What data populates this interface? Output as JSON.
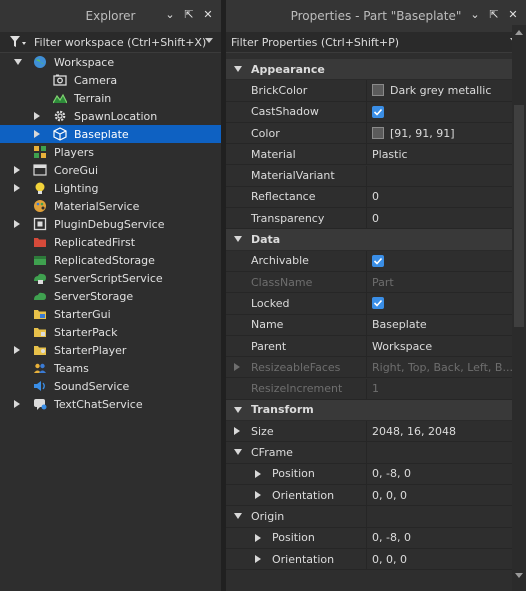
{
  "explorer": {
    "title": "Explorer",
    "filter_placeholder": "Filter workspace (Ctrl+Shift+X)",
    "items": [
      {
        "label": "Workspace",
        "icon": "globe-icon",
        "expander": "down",
        "indent": 0
      },
      {
        "label": "Camera",
        "icon": "camera-icon",
        "expander": "none",
        "indent": 2
      },
      {
        "label": "Terrain",
        "icon": "terrain-icon",
        "expander": "none",
        "indent": 2
      },
      {
        "label": "SpawnLocation",
        "icon": "gear-icon",
        "expander": "right",
        "indent": 1
      },
      {
        "label": "Baseplate",
        "icon": "cube-icon",
        "expander": "right",
        "indent": 1,
        "selected": true
      },
      {
        "label": "Players",
        "icon": "players-icon",
        "expander": "none",
        "indent": 0
      },
      {
        "label": "CoreGui",
        "icon": "window-icon",
        "expander": "right",
        "indent": 0
      },
      {
        "label": "Lighting",
        "icon": "lightbulb-icon",
        "expander": "right",
        "indent": 0
      },
      {
        "label": "MaterialService",
        "icon": "palette-icon",
        "expander": "none",
        "indent": 0
      },
      {
        "label": "PluginDebugService",
        "icon": "square-icon",
        "expander": "right",
        "indent": 0
      },
      {
        "label": "ReplicatedFirst",
        "icon": "red-folder-icon",
        "expander": "none",
        "indent": 0
      },
      {
        "label": "ReplicatedStorage",
        "icon": "green-box-icon",
        "expander": "none",
        "indent": 0
      },
      {
        "label": "ServerScriptService",
        "icon": "script-service-icon",
        "expander": "none",
        "indent": 0
      },
      {
        "label": "ServerStorage",
        "icon": "cloud-icon",
        "expander": "none",
        "indent": 0
      },
      {
        "label": "StarterGui",
        "icon": "folder-gui-icon",
        "expander": "none",
        "indent": 0
      },
      {
        "label": "StarterPack",
        "icon": "folder-pack-icon",
        "expander": "none",
        "indent": 0
      },
      {
        "label": "StarterPlayer",
        "icon": "folder-player-icon",
        "expander": "right",
        "indent": 0
      },
      {
        "label": "Teams",
        "icon": "teams-icon",
        "expander": "none",
        "indent": 0
      },
      {
        "label": "SoundService",
        "icon": "speaker-icon",
        "expander": "none",
        "indent": 0
      },
      {
        "label": "TextChatService",
        "icon": "chat-icon",
        "expander": "right",
        "indent": 0
      }
    ]
  },
  "properties": {
    "title": "Properties - Part \"Baseplate\"",
    "filter_placeholder": "Filter Properties (Ctrl+Shift+P)",
    "rows": [
      {
        "kind": "cat",
        "name": "Appearance",
        "expander": "down"
      },
      {
        "kind": "prop",
        "name": "BrickColor",
        "value": "Dark grey metallic",
        "swatch": "#5b5b5b"
      },
      {
        "kind": "prop",
        "name": "CastShadow",
        "checkbox": true
      },
      {
        "kind": "prop",
        "name": "Color",
        "value": "[91, 91, 91]",
        "swatch": "#5b5b5b"
      },
      {
        "kind": "prop",
        "name": "Material",
        "value": "Plastic"
      },
      {
        "kind": "prop",
        "name": "MaterialVariant",
        "value": ""
      },
      {
        "kind": "prop",
        "name": "Reflectance",
        "value": "0"
      },
      {
        "kind": "prop",
        "name": "Transparency",
        "value": "0"
      },
      {
        "kind": "cat",
        "name": "Data",
        "expander": "down"
      },
      {
        "kind": "prop",
        "name": "Archivable",
        "checkbox": true
      },
      {
        "kind": "prop",
        "name": "ClassName",
        "value": "Part",
        "disabled": true
      },
      {
        "kind": "prop",
        "name": "Locked",
        "checkbox": true
      },
      {
        "kind": "prop",
        "name": "Name",
        "value": "Baseplate"
      },
      {
        "kind": "prop",
        "name": "Parent",
        "value": "Workspace"
      },
      {
        "kind": "prop",
        "name": "ResizeableFaces",
        "value": "Right, Top, Back, Left, B...",
        "disabled": true,
        "expander": "right"
      },
      {
        "kind": "prop",
        "name": "ResizeIncrement",
        "value": "1",
        "disabled": true
      },
      {
        "kind": "cat",
        "name": "Transform",
        "expander": "down"
      },
      {
        "kind": "prop",
        "name": "Size",
        "value": "2048, 16, 2048",
        "expander": "right"
      },
      {
        "kind": "prop",
        "name": "CFrame",
        "value": "",
        "expander": "down"
      },
      {
        "kind": "prop",
        "name": "Position",
        "value": "0, -8, 0",
        "sub": true,
        "expander": "right"
      },
      {
        "kind": "prop",
        "name": "Orientation",
        "value": "0, 0, 0",
        "sub": true,
        "expander": "right"
      },
      {
        "kind": "prop",
        "name": "Origin",
        "value": "",
        "expander": "down"
      },
      {
        "kind": "prop",
        "name": "Position",
        "value": "0, -8, 0",
        "sub": true,
        "expander": "right"
      },
      {
        "kind": "prop",
        "name": "Orientation",
        "value": "0, 0, 0",
        "sub": true,
        "expander": "right"
      }
    ]
  },
  "colors": {
    "accent": "#0e61c2",
    "checkbox": "#3a8ee6"
  }
}
